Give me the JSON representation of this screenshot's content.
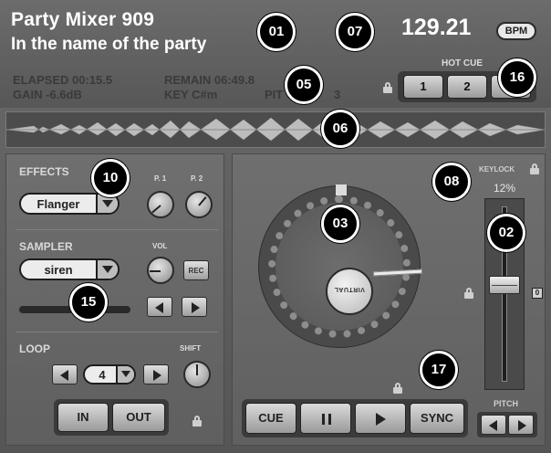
{
  "track": {
    "title": "Party Mixer 909",
    "artist": "In the name of the party"
  },
  "bpm": {
    "value": "129.21",
    "badge": "BPM"
  },
  "info": {
    "elapsed": "ELAPSED 00:15.5",
    "remain": "REMAIN 06:49.8",
    "gain": "GAIN -6.6dB",
    "key": "KEY C#m",
    "pitch": "PIT",
    "pitch_tail": "3"
  },
  "hotcue": {
    "label": "HOT CUE",
    "buttons": [
      "1",
      "2"
    ]
  },
  "effects": {
    "label": "EFFECTS",
    "selected": "Flanger",
    "p1": "P. 1",
    "p2": "P. 2"
  },
  "sampler": {
    "label": "SAMPLER",
    "selected": "siren",
    "vol": "VOL",
    "rec": "REC"
  },
  "loop": {
    "label": "LOOP",
    "shift": "SHIFT",
    "value": "4",
    "in": "IN",
    "out": "OUT"
  },
  "deck": {
    "logo": "VIRTUAL"
  },
  "keylock": {
    "label": "KEYLOCK",
    "value": "12%"
  },
  "pitch_slider": {
    "label": "PITCH",
    "zero": "0"
  },
  "transport": {
    "cue": "CUE",
    "sync": "SYNC"
  },
  "callouts": [
    "01",
    "07",
    "05",
    "16",
    "06",
    "10",
    "08",
    "03",
    "02",
    "15",
    "17"
  ],
  "colors": {
    "panel": "#6a6a6a",
    "button": "#c8c8c8",
    "callout": "#000000"
  }
}
